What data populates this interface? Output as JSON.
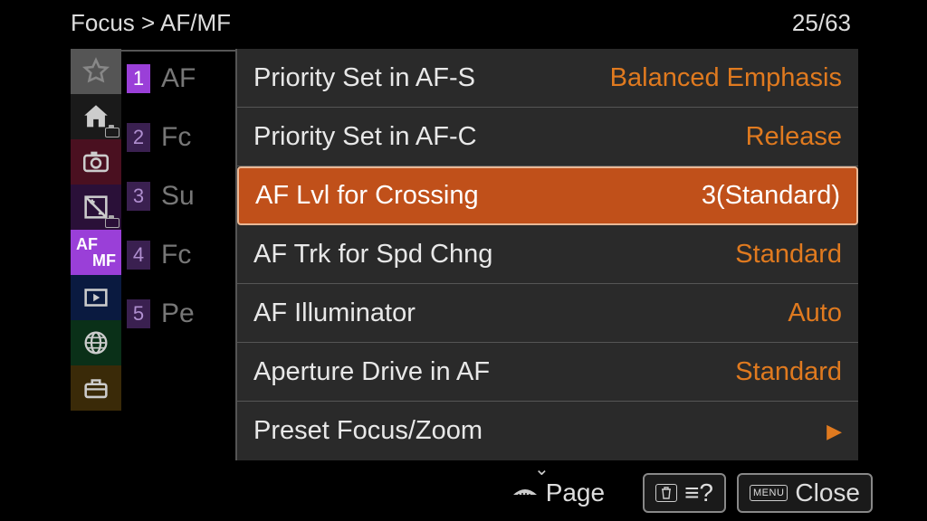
{
  "breadcrumb": {
    "parent": "Focus",
    "sep": ">",
    "current": "AF/MF"
  },
  "page_counter": "25/63",
  "icon_strip": [
    {
      "name": "favorites-icon"
    },
    {
      "name": "home-icon"
    },
    {
      "name": "camera-icon"
    },
    {
      "name": "exposure-icon"
    },
    {
      "name": "afmf-icon",
      "af": "AF",
      "mf": "MF"
    },
    {
      "name": "playback-icon"
    },
    {
      "name": "network-icon"
    },
    {
      "name": "toolbox-icon"
    }
  ],
  "sub_list": [
    {
      "num": "1",
      "label": "AF",
      "active": true
    },
    {
      "num": "2",
      "label": "Fc"
    },
    {
      "num": "3",
      "label": "Su"
    },
    {
      "num": "4",
      "label": "Fc"
    },
    {
      "num": "5",
      "label": "Pe"
    }
  ],
  "settings": [
    {
      "label": "Priority Set in AF-S",
      "value": "Balanced Emphasis",
      "selected": false
    },
    {
      "label": "Priority Set in AF-C",
      "value": "Release",
      "selected": false
    },
    {
      "label": "AF Lvl for Crossing",
      "value": "3(Standard)",
      "selected": true
    },
    {
      "label": "AF Trk for Spd Chng",
      "value": "Standard",
      "selected": false
    },
    {
      "label": "AF Illuminator",
      "value": "Auto",
      "selected": false
    },
    {
      "label": "Aperture Drive in AF",
      "value": "Standard",
      "selected": false
    },
    {
      "label": "Preset Focus/Zoom",
      "value": "",
      "submenu": true,
      "selected": false
    }
  ],
  "bottom": {
    "page_label": "Page",
    "help_hint": "≡?",
    "close_label": "Close",
    "menu_chip": "MENU"
  }
}
